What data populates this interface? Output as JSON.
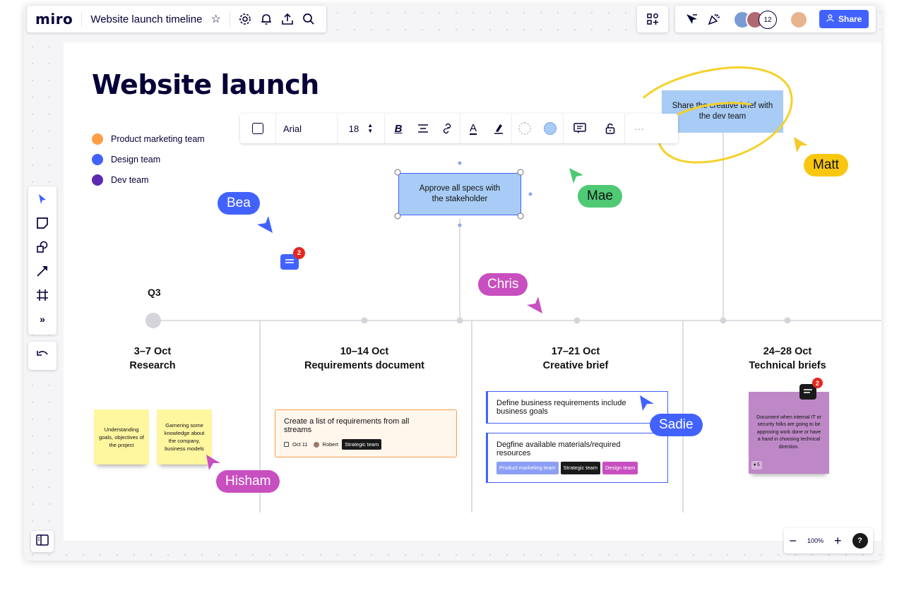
{
  "header": {
    "logo": "miro",
    "board_title": "Website launch timeline",
    "avatar_count": "12",
    "share_label": "Share"
  },
  "canvas": {
    "title": "Website launch",
    "legend": [
      {
        "label": "Product marketing team",
        "color": "#ff9d48"
      },
      {
        "label": "Design team",
        "color": "#4262ff"
      },
      {
        "label": "Dev team",
        "color": "#5d2bb2"
      }
    ],
    "quarter": "Q3",
    "selected_shape_text": "Approve all specs with the stakeholder",
    "top_right_shape_text": "Share the creative brief with the dev team",
    "comment_badge_count": "2",
    "columns": [
      {
        "date": "3–7 Oct",
        "title": "Research"
      },
      {
        "date": "10–14 Oct",
        "title": "Requirements document"
      },
      {
        "date": "17–21 Oct",
        "title": "Creative brief"
      },
      {
        "date": "24–28 Oct",
        "title": "Technical briefs"
      }
    ],
    "stickies": [
      {
        "text": "Understanding goals, objectives of the project"
      },
      {
        "text": "Garnering some knowledge about the company, business models"
      }
    ],
    "requirements_card": {
      "text": "Create a list of requirements from all streams",
      "date": "Oct 11",
      "assignee": "Robert",
      "tag": "Strategic team"
    },
    "creative_cards": [
      {
        "text": "Define business requirements include business goals"
      },
      {
        "text": "Degfine available materials/required resources",
        "tags": [
          "Product marketing team",
          "Strategic team",
          "Design team"
        ]
      }
    ],
    "tech_sticky": {
      "text": "Document when internal IT or security folks are going to be approving work done or have a hand in choosing technical direction.",
      "comment_count": "2",
      "reaction": "5"
    }
  },
  "cursors": [
    {
      "name": "Bea",
      "color": "#4262ff"
    },
    {
      "name": "Mae",
      "color": "#4fc974"
    },
    {
      "name": "Matt",
      "color": "#fac710"
    },
    {
      "name": "Chris",
      "color": "#c84fc0"
    },
    {
      "name": "Sadie",
      "color": "#4262ff"
    },
    {
      "name": "Hisham",
      "color": "#c84fc0"
    }
  ],
  "format_toolbar": {
    "font": "Arial",
    "size": "18"
  },
  "zoom": {
    "level": "100%"
  },
  "colors": {
    "accent": "#4262ff",
    "sticky_yellow": "#fff6a0",
    "sticky_purple": "#be88c7",
    "shape_blue": "#a8ccf5"
  }
}
